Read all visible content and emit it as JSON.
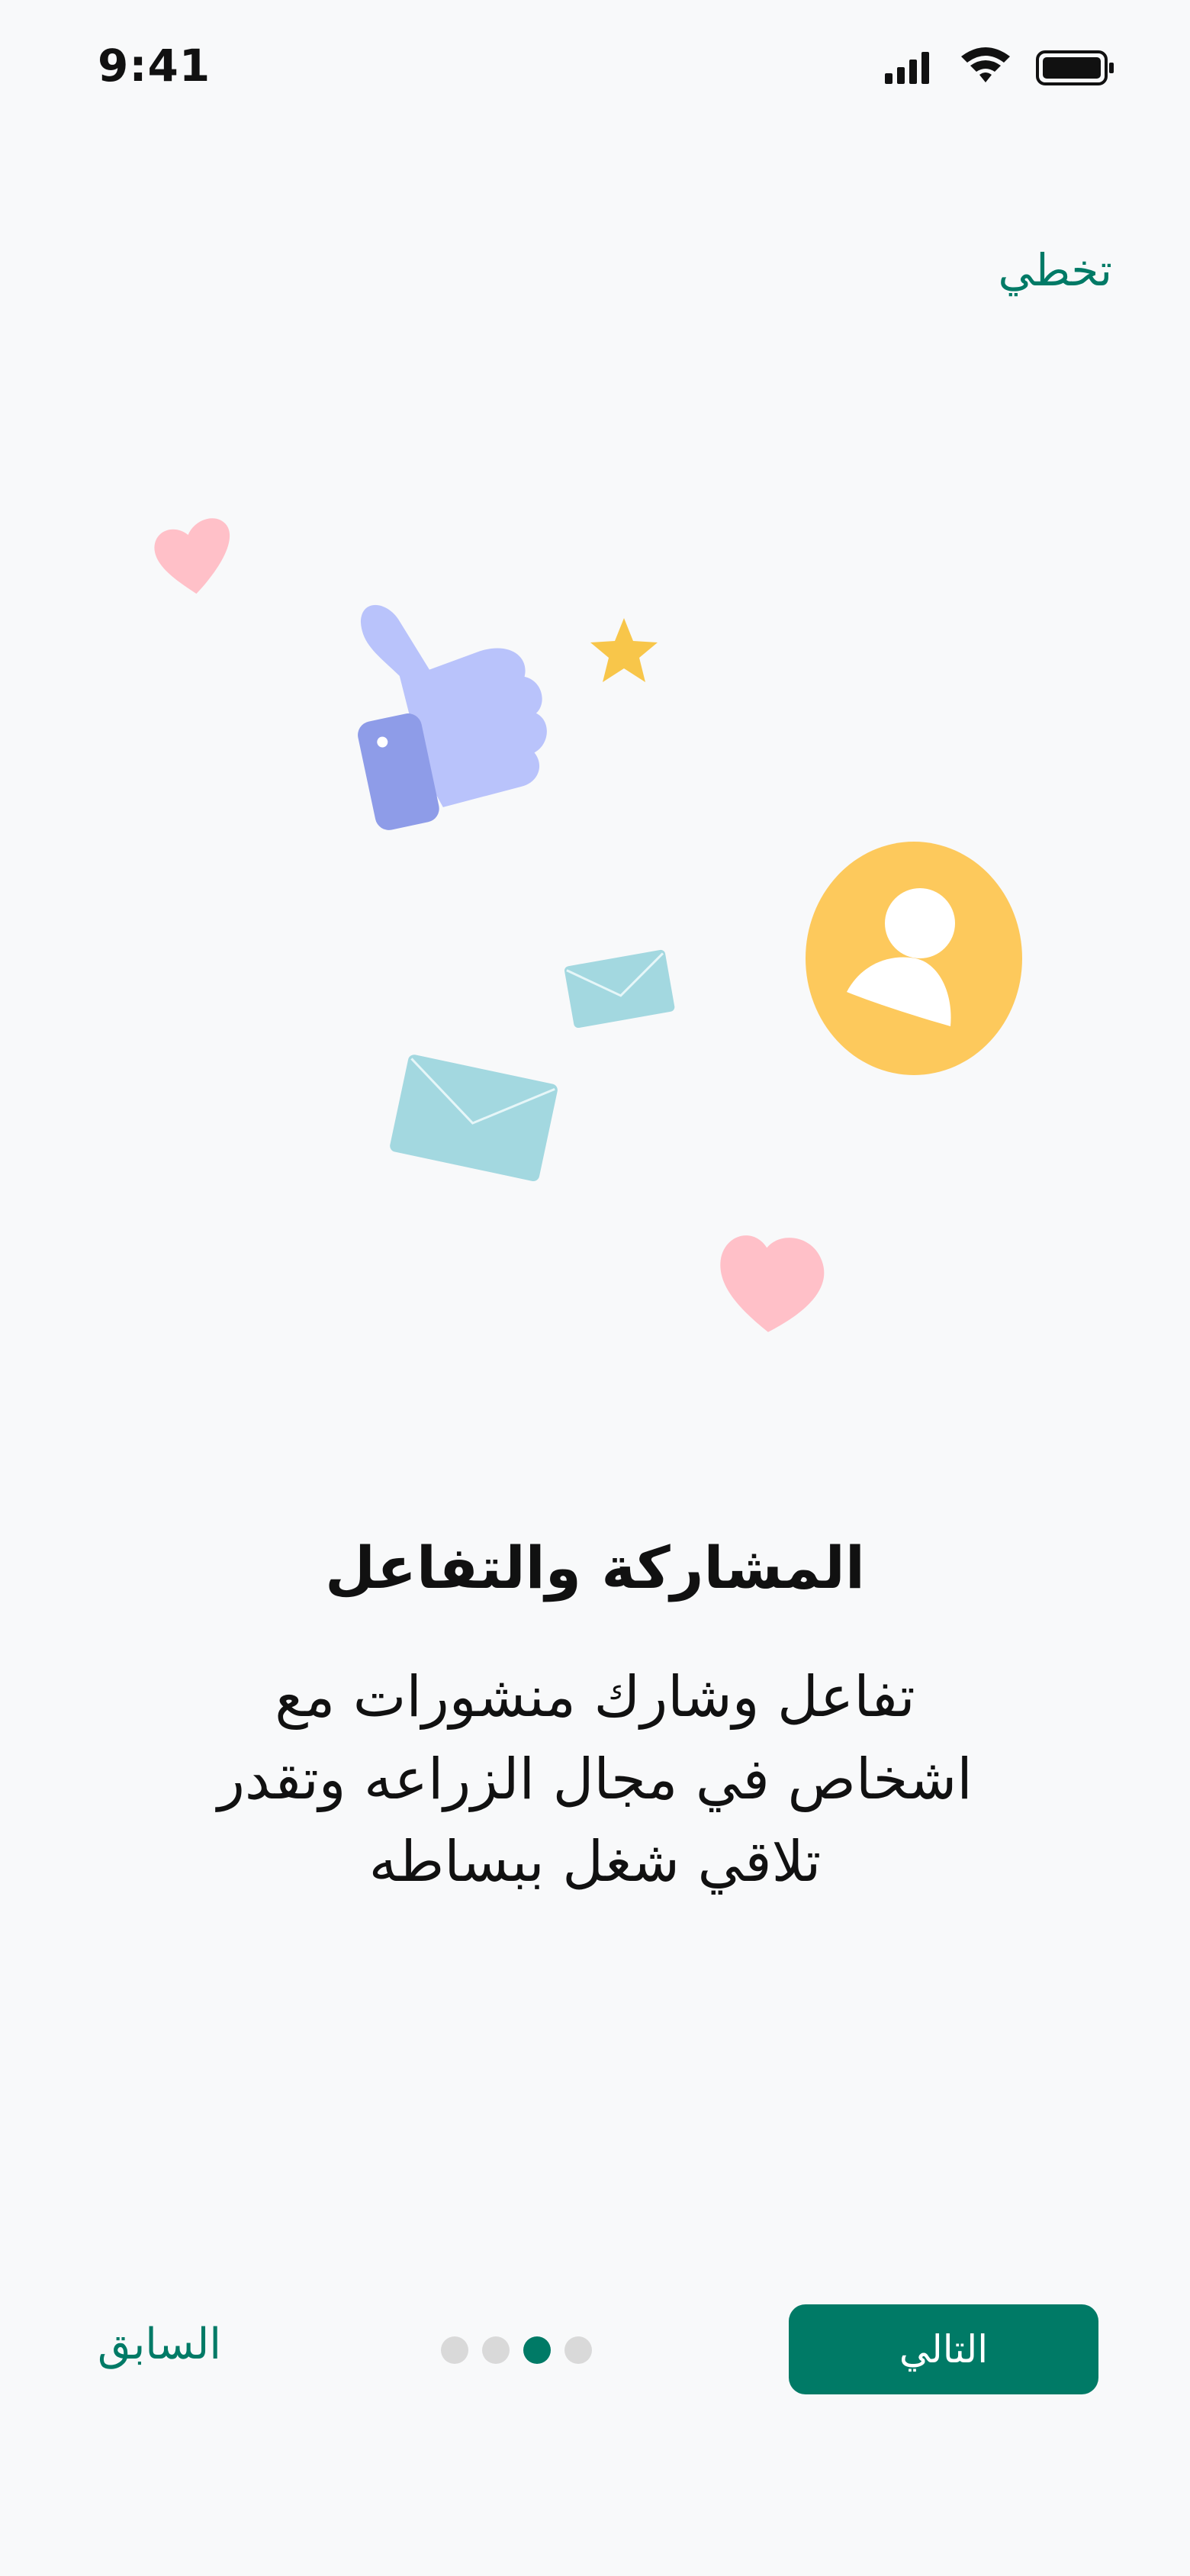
{
  "status_bar": {
    "time": "9:41",
    "icons": [
      "signal-icon",
      "wifi-icon",
      "battery-icon"
    ]
  },
  "header": {
    "skip_label": "تخطي"
  },
  "illustration": {
    "icons": [
      "heart-icon",
      "thumbs-up-icon",
      "star-icon",
      "envelope-icon",
      "envelope-icon",
      "user-avatar-icon",
      "heart-icon"
    ]
  },
  "content": {
    "title": "المشاركة والتفاعل",
    "description_lines": [
      "تفاعل وشارك منشورات مع",
      "اشخاص في مجال الزراعه وتقدر",
      "تلاقي شغل ببساطه"
    ]
  },
  "footer": {
    "prev_label": "السابق",
    "next_label": "التالي",
    "page_indicator": {
      "total": 4,
      "active_index": 2
    }
  },
  "colors": {
    "primary": "#007a66",
    "background": "#f8f9fa",
    "dot_inactive": "#d9d9d9",
    "heart": "#ffc0c8",
    "thumb": "#b9c3fb",
    "thumb_cuff": "#8e9ce8",
    "star": "#f8c64a",
    "envelope": "#a3d8e0",
    "avatar": "#fdc95c"
  }
}
